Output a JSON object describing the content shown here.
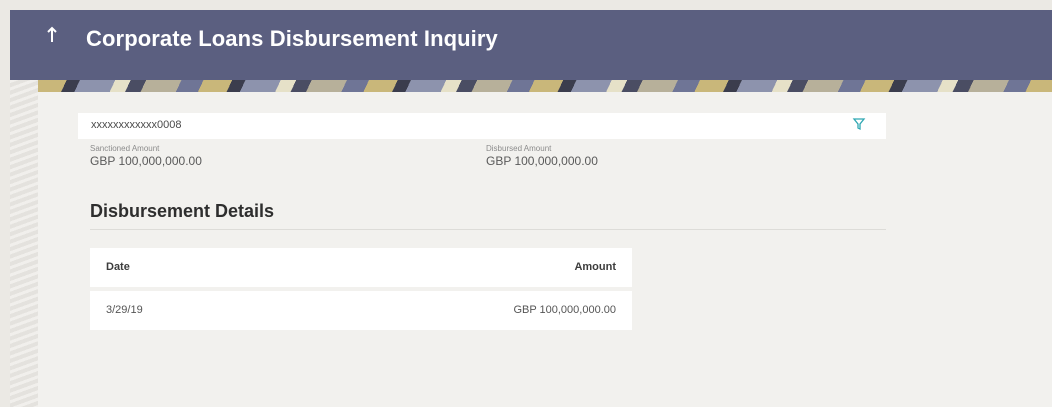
{
  "header": {
    "title": "Corporate Loans Disbursement Inquiry",
    "back_icon": "up-arrow-icon"
  },
  "account": {
    "number": "xxxxxxxxxxxx0008",
    "filter_icon": "filter-icon"
  },
  "summary": {
    "sanctioned_label": "Sanctioned Amount",
    "sanctioned_value": "GBP 100,000,000.00",
    "disbursed_label": "Disbursed Amount",
    "disbursed_value": "GBP 100,000,000.00"
  },
  "disbursement": {
    "title": "Disbursement Details",
    "columns": [
      "Date",
      "Amount"
    ],
    "rows": [
      {
        "date": "3/29/19",
        "amount": "GBP 100,000,000.00"
      }
    ]
  }
}
